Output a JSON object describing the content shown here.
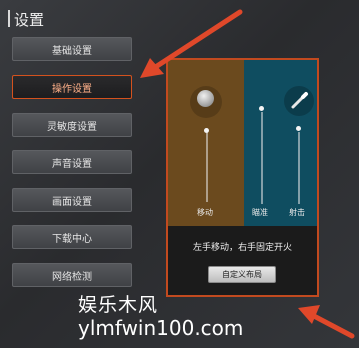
{
  "header": {
    "title": "设置"
  },
  "sidebar": {
    "items": [
      {
        "label": "基础设置",
        "active": false
      },
      {
        "label": "操作设置",
        "active": true
      },
      {
        "label": "灵敏度设置",
        "active": false
      },
      {
        "label": "声音设置",
        "active": false
      },
      {
        "label": "画面设置",
        "active": false
      },
      {
        "label": "下载中心",
        "active": false
      },
      {
        "label": "网络检测",
        "active": false
      }
    ]
  },
  "panel": {
    "move_label": "移动",
    "aim_label": "瞄准",
    "fire_label": "射击",
    "tip": "左手移动，右手固定开火",
    "custom_button": "自定义布局",
    "left_color": "#6b4a1e",
    "right_color": "#0f4d60",
    "border_color": "#c24a1f"
  },
  "annotations": {
    "arrow_color": "#e0482a"
  },
  "watermark": {
    "name": "娱乐木风",
    "url": "ylmfwin100.com"
  }
}
